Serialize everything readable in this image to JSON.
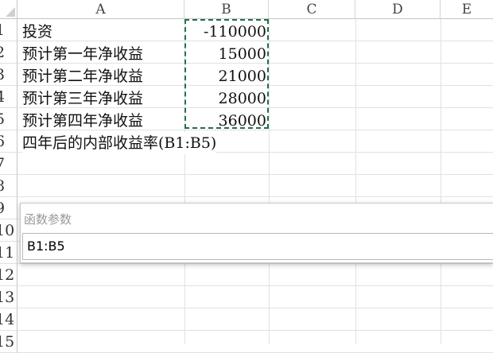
{
  "columns": [
    "A",
    "B",
    "C",
    "D",
    "E"
  ],
  "row_numbers": [
    "1",
    "2",
    "3",
    "4",
    "5",
    "6",
    "7",
    "8",
    "9",
    "10",
    "11",
    "12",
    "13",
    "14",
    "15"
  ],
  "cells": [
    {
      "a": "投资",
      "b": "-110000"
    },
    {
      "a": "预计第一年净收益",
      "b": "15000"
    },
    {
      "a": "预计第二年净收益",
      "b": "21000"
    },
    {
      "a": "预计第三年净收益",
      "b": "28000"
    },
    {
      "a": "预计第四年净收益",
      "b": "36000"
    },
    {
      "a": "四年后的内部收益率(B1:B5)",
      "b": ""
    }
  ],
  "dialog": {
    "title": "函数参数",
    "value": "B1:B5"
  },
  "colors": {
    "selection": "#1e7145"
  }
}
